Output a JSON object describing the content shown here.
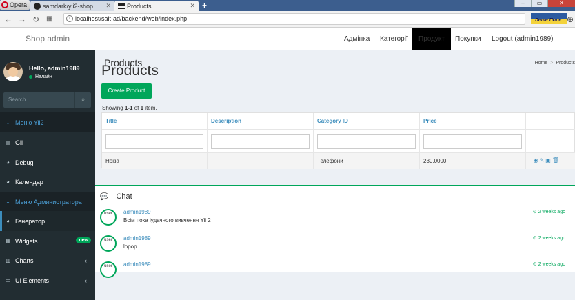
{
  "browser": {
    "opera_label": "Opera",
    "tabs": [
      {
        "title": "samdark/yii2-shop"
      },
      {
        "title": "Products"
      }
    ],
    "new_tab_icon": "+",
    "url": "localhost/sait-ad/backend/web/index.php",
    "flag_text": "Лепіе Поле",
    "accent": "#3c5e8e"
  },
  "header": {
    "logo": "Shop admin",
    "nav": [
      {
        "label": "Адмінка"
      },
      {
        "label": "Категорії"
      },
      {
        "label": "Продукт",
        "active": true
      },
      {
        "label": "Покупки"
      },
      {
        "label": "Logout (admin1989)"
      }
    ]
  },
  "sidebar": {
    "user_name": "Hello, admin1989",
    "status": "Налайн",
    "search_placeholder": "Search...",
    "items": [
      {
        "label": "Меню Yii2",
        "icon": "chevron-down-icon",
        "header": true
      },
      {
        "label": "Gii",
        "icon": "file-code-icon"
      },
      {
        "label": "Debug",
        "icon": "dashboard-icon"
      },
      {
        "label": "Календар",
        "icon": "dashboard-icon"
      },
      {
        "label": "Меню Администратора",
        "icon": "chevron-down-icon",
        "header": true
      },
      {
        "label": "Генератор",
        "icon": "dashboard-icon",
        "active": true
      },
      {
        "label": "Widgets",
        "icon": "th-icon",
        "badge": "new"
      },
      {
        "label": "Charts",
        "icon": "bar-chart-icon",
        "chevron": "‹"
      },
      {
        "label": "UI Elements",
        "icon": "laptop-icon",
        "chevron": "‹"
      }
    ]
  },
  "content": {
    "header_title": "Products",
    "breadcrumb": [
      "Home",
      "Products"
    ],
    "page_title": "Products",
    "create_button": "Create Product",
    "summary_prefix": "Showing ",
    "summary_range": "1-1",
    "summary_mid": " of ",
    "summary_total": "1",
    "summary_suffix": " item.",
    "grid": {
      "columns": [
        "Title",
        "Description",
        "Category ID",
        "Price"
      ],
      "rows": [
        {
          "title": "Нокіа",
          "description": "",
          "category": "Телефони",
          "price": "230.0000"
        }
      ]
    }
  },
  "chat": {
    "title": "Chat",
    "messages": [
      {
        "avatar_alt": "user",
        "name": "admin1989",
        "text": "Всім пока іудачного вивчення Yii 2",
        "time": "2 weeks ago"
      },
      {
        "avatar_alt": "user",
        "name": "admin1989",
        "text": "lopop",
        "time": "2 weeks ago"
      },
      {
        "avatar_alt": "user",
        "name": "admin1989",
        "text": "",
        "time": "2 weeks ago"
      }
    ]
  }
}
